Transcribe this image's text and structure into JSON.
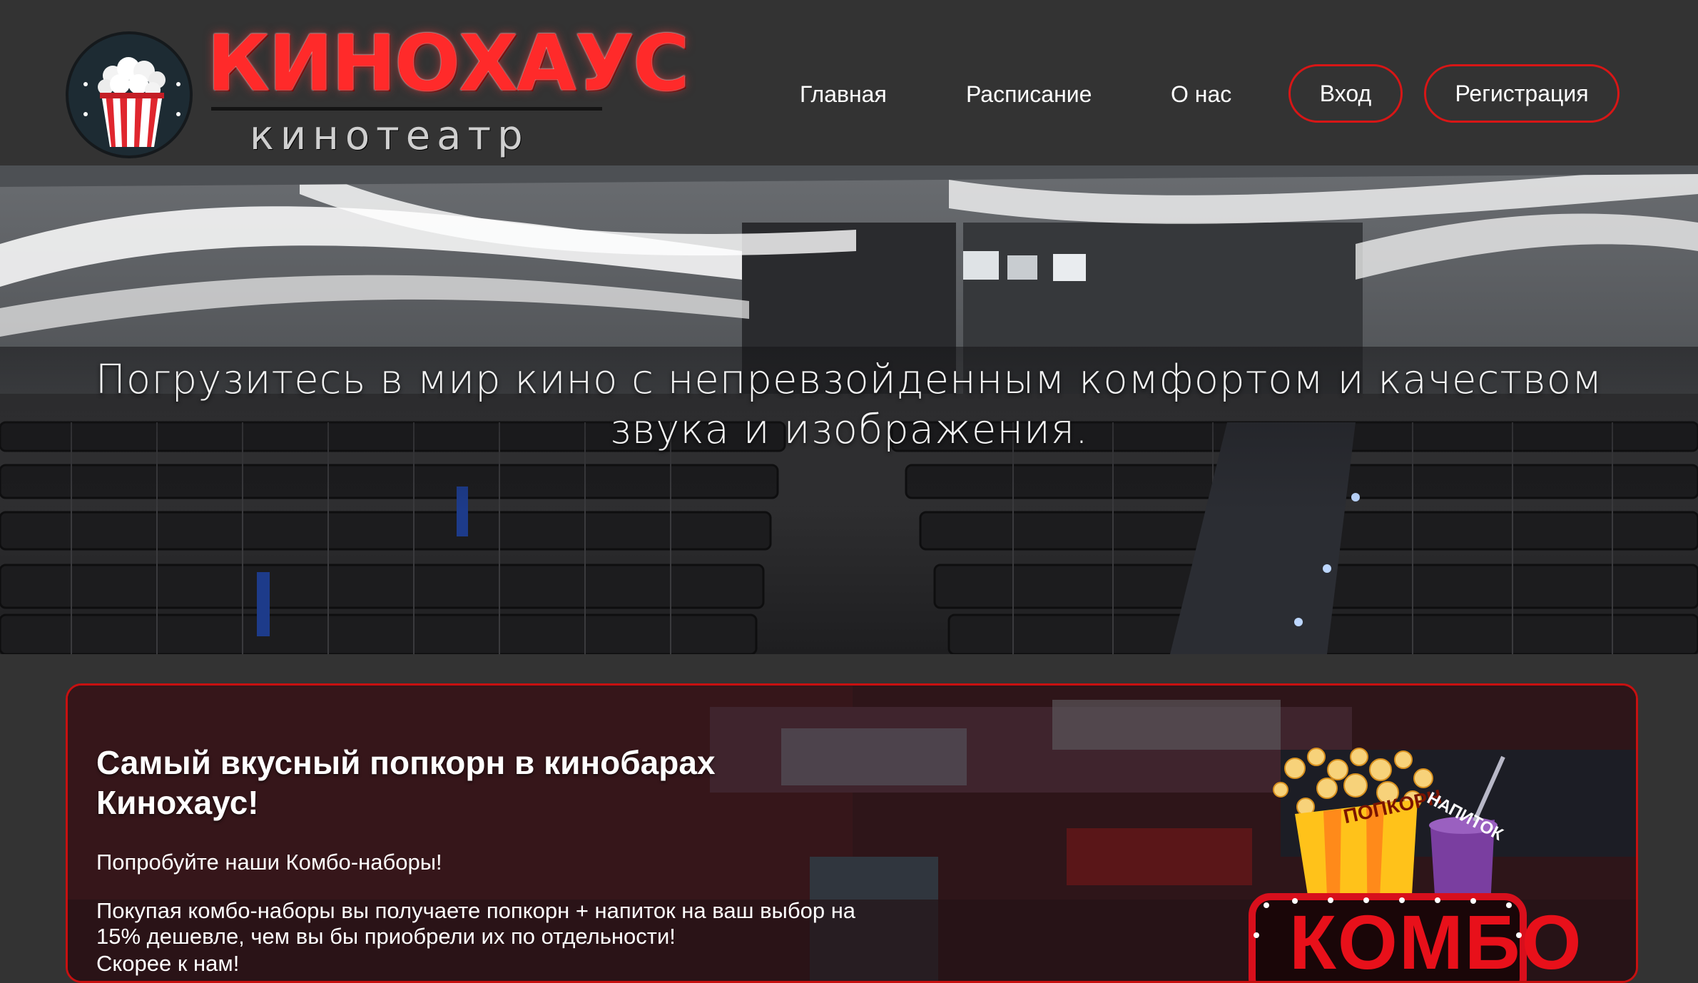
{
  "brand": {
    "title": "КИНОХАУС",
    "subtitle": "кинотеатр",
    "logo_icon": "popcorn-icon"
  },
  "nav": {
    "links": [
      "Главная",
      "Расписание",
      "О нас"
    ],
    "login_label": "Вход",
    "register_label": "Регистрация"
  },
  "hero": {
    "headline": "Погрузитесь в мир кино с непревзойденным комфортом и качеством звука и изображения."
  },
  "promo": {
    "title": "Самый вкусный попкорн в кинобарах Кинохаус!",
    "line1": "Попробуйте наши Комбо-наборы!",
    "line2": "Покупая комбо-наборы вы получаете попкорн + напиток на ваш выбор на 15% дешевле, чем вы бы приобрели их по отдельности!",
    "line3": "Скорее к нам!",
    "art": {
      "popcorn_label": "ПОПКОРН",
      "drink_label": "НАПИТОК",
      "combo_word": "КОМБО"
    }
  },
  "colors": {
    "background": "#333333",
    "accent": "#d81616",
    "text": "#ffffff"
  }
}
